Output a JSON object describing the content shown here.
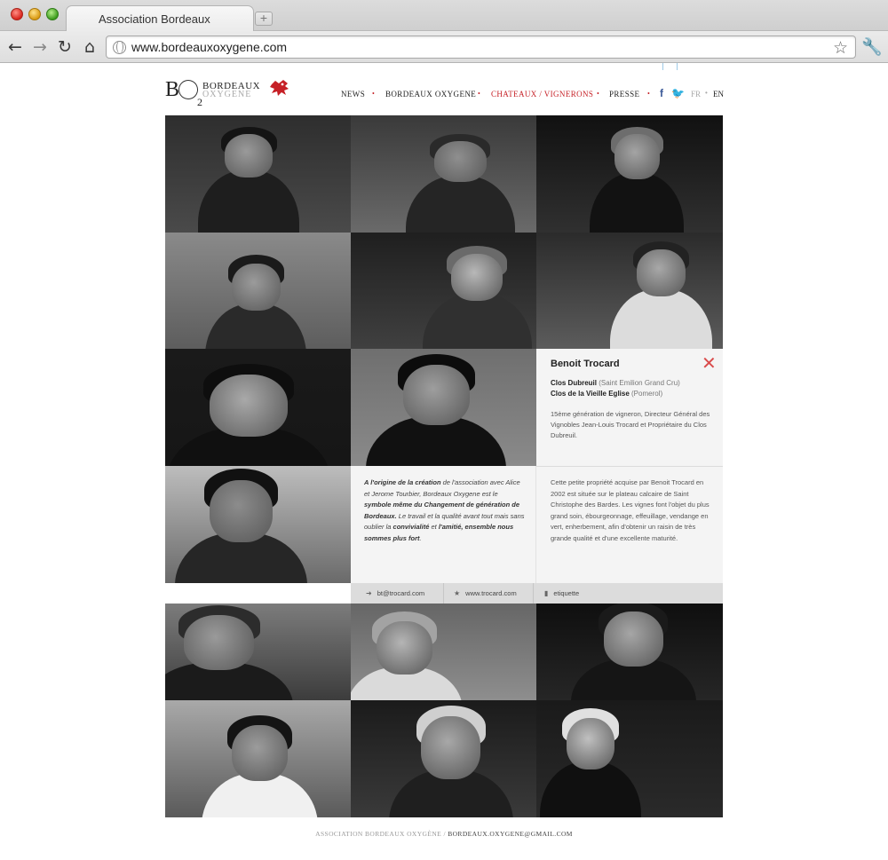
{
  "browser": {
    "tab_title": "Association Bordeaux Oxygène",
    "new_tab_label": "+",
    "url": "www.bordeauxoxygene.com"
  },
  "site": {
    "logo": {
      "letter": "B",
      "subscript": "2",
      "line1": "BORDEAUX",
      "line2": "OXYGENE"
    },
    "nav": [
      {
        "label": "NEWS",
        "active": false
      },
      {
        "label": "BORDEAUX OXYGENE",
        "active": false
      },
      {
        "label": "CHATEAUX / VIGNERONS",
        "active": true
      },
      {
        "label": "PRESSE",
        "active": false
      }
    ],
    "nav_separator": "•",
    "social": {
      "facebook": "f",
      "twitter": "t"
    },
    "languages": {
      "fr": "FR",
      "separator": "•",
      "en": "EN"
    },
    "accent_color": "#c62026"
  },
  "detail": {
    "close_glyph": "✕",
    "name": "Benoit Trocard",
    "chateaux": [
      {
        "name": "Clos Dubreuil",
        "appellation": "(Saint Emilion Grand Cru)"
      },
      {
        "name": "Clos de la Vieille Eglise",
        "appellation": "(Pomerol)"
      }
    ],
    "bio": "15ème génération de vigneron, Directeur Général des Vignobles Jean-Louis Trocard et Propriétaire du Clos Dubreuil.",
    "description": "Cette petite propriété acquise par Benoit Trocard en 2002 est située sur le plateau calcaire de Saint Christophe des Bardes. Les vignes font l'objet du plus grand soin, ébourgeonnage, effeuillage, vendange en vert, enherbement, afin d'obtenir un raisin de très grande qualité et d'une excellente maturité."
  },
  "quote": {
    "p1_bold": "A l'origine de la création",
    "p1_rest": " de l'association avec Alice et Jerome Tourbier, Bordeaux Oxygene est le ",
    "p2_bold": "symbole même du Changement de génération de Bordeaux.",
    "p3": " Le travail et la qualité avant tout mais sans oublier la ",
    "p4_bold": "convivialité",
    "p5": " et ",
    "p6_bold": "l'amitié, ensemble nous sommes plus fort",
    "p7": "."
  },
  "links": [
    {
      "icon": "arrow-icon",
      "glyph": "➜",
      "label": "bt@trocard.com"
    },
    {
      "icon": "star-icon",
      "glyph": "★",
      "label": "www.trocard.com"
    },
    {
      "icon": "document-icon",
      "glyph": "▮",
      "label": "etiquette"
    }
  ],
  "footer": {
    "left": "ASSOCIATION BORDEAUX OXYGÈNE",
    "separator": " / ",
    "email": "BORDEAUX.OXYGENE@GMAIL.COM"
  }
}
